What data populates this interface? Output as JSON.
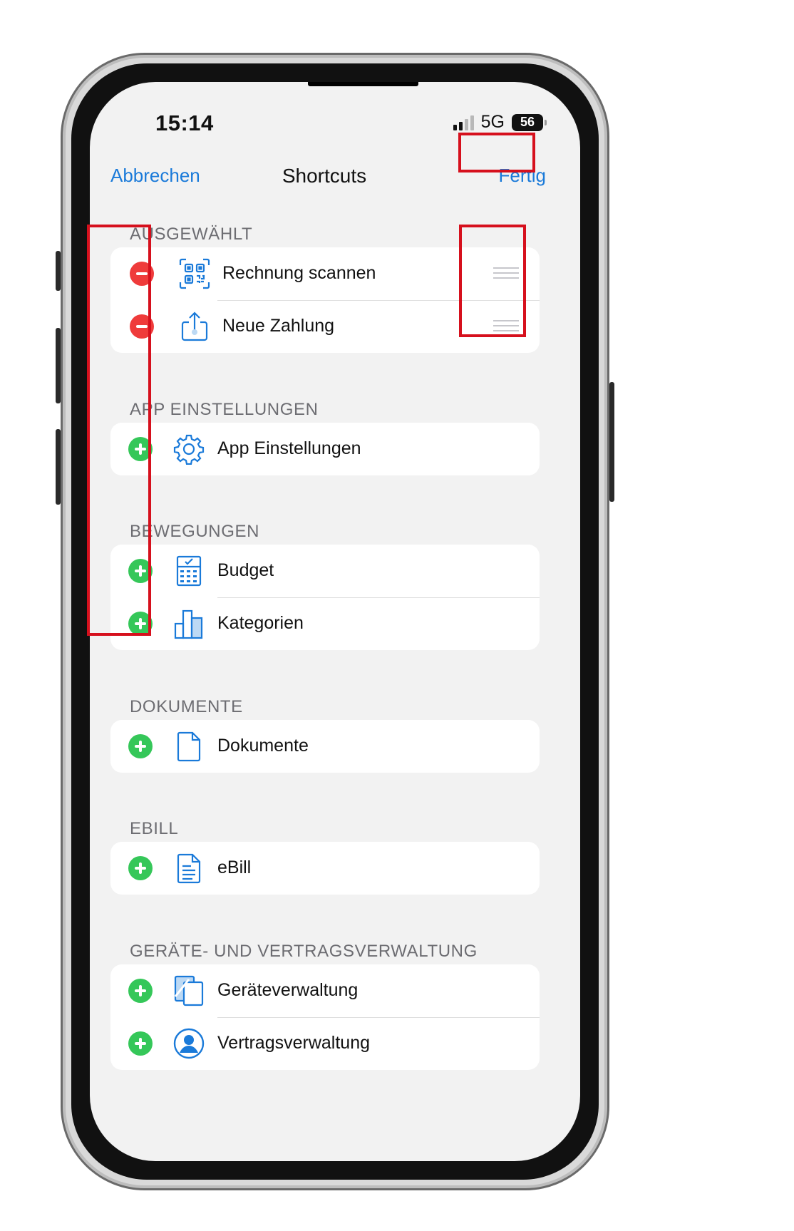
{
  "status_bar": {
    "time": "15:14",
    "network": "5G",
    "battery": "56"
  },
  "nav": {
    "cancel_label": "Abbrechen",
    "title": "Shortcuts",
    "done_label": "Fertig"
  },
  "sections": [
    {
      "label": "AUSGEWÄHLT",
      "items": [
        {
          "label": "Rechnung scannen",
          "action": "remove",
          "icon": "qr-code-icon"
        },
        {
          "label": "Neue Zahlung",
          "action": "remove",
          "icon": "share-upload-icon"
        }
      ]
    },
    {
      "label": "APP EINSTELLUNGEN",
      "items": [
        {
          "label": "App Einstellungen",
          "action": "add",
          "icon": "gear-icon"
        }
      ]
    },
    {
      "label": "BEWEGUNGEN",
      "items": [
        {
          "label": "Budget",
          "action": "add",
          "icon": "calculator-icon"
        },
        {
          "label": "Kategorien",
          "action": "add",
          "icon": "bar-chart-icon"
        }
      ]
    },
    {
      "label": "DOKUMENTE",
      "items": [
        {
          "label": "Dokumente",
          "action": "add",
          "icon": "document-icon"
        }
      ]
    },
    {
      "label": "EBILL",
      "items": [
        {
          "label": "eBill",
          "action": "add",
          "icon": "bill-icon"
        }
      ]
    },
    {
      "label": "GERÄTE- UND VERTRAGSVERWALTUNG",
      "items": [
        {
          "label": "Geräteverwaltung",
          "action": "add",
          "icon": "devices-icon"
        },
        {
          "label": "Vertragsverwaltung",
          "action": "add",
          "icon": "contract-person-icon"
        }
      ]
    }
  ],
  "colors": {
    "accent": "#1a7ad9",
    "remove": "#ef3b3b",
    "add": "#35c759",
    "highlight": "#d6101d",
    "icon": "#1a7ad9"
  }
}
